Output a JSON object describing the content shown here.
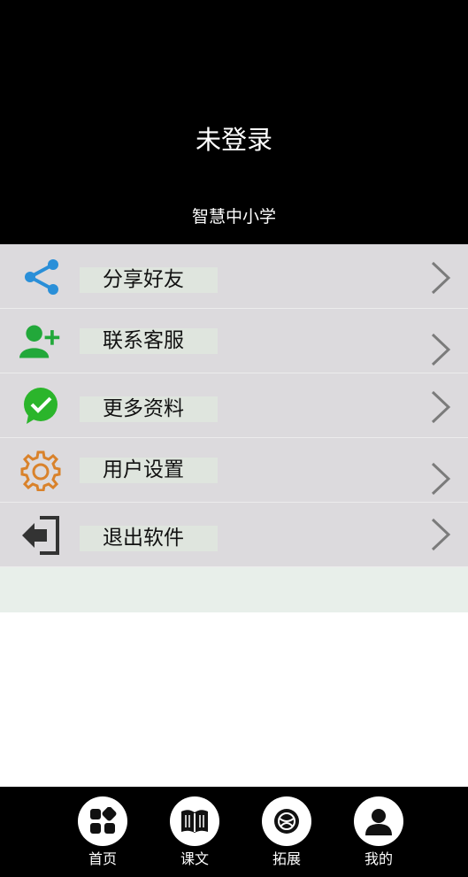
{
  "header": {
    "login_status": "未登录",
    "app_name": "智慧中小学",
    "background": "#000000"
  },
  "menu": {
    "items": [
      {
        "label": "分享好友",
        "icon": "share-icon",
        "icon_color": "#2a8fd8"
      },
      {
        "label": "联系客服",
        "icon": "add-user-icon",
        "icon_color": "#22a83a"
      },
      {
        "label": "更多资料",
        "icon": "wechat-check-icon",
        "icon_color": "#2bb52b"
      },
      {
        "label": "用户设置",
        "icon": "gear-icon",
        "icon_color": "#d9822b"
      },
      {
        "label": "退出软件",
        "icon": "exit-icon",
        "icon_color": "#333333"
      }
    ]
  },
  "tabbar": {
    "tabs": [
      {
        "label": "首页",
        "icon": "home-grid-icon"
      },
      {
        "label": "课文",
        "icon": "book-icon"
      },
      {
        "label": "拓展",
        "icon": "globe-icon"
      },
      {
        "label": "我的",
        "icon": "person-icon"
      }
    ],
    "active_tab": "我的"
  }
}
